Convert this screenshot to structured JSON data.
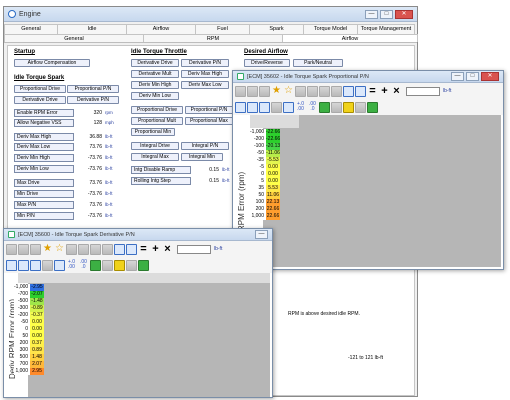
{
  "main": {
    "title": "Engine",
    "tabs_row1": [
      "General",
      "Idle",
      "Airflow",
      "Fuel",
      "Spark",
      "Torque Model",
      "Torque Management"
    ],
    "tabs_row2": [
      "General",
      "RPM",
      "Airflow"
    ],
    "startup": {
      "heading": "Startup",
      "airflow_comp": "Airflow Compensation"
    },
    "idle_spark": {
      "heading": "Idle Torque Spark",
      "buttons": [
        "Proportional Drive",
        "Proportional P/N",
        "Derivative Drive",
        "Derivative P/N"
      ],
      "values": [
        {
          "label": "Enable RPM Error",
          "value": "320",
          "unit": "rpm"
        },
        {
          "label": "Allow Negative VSS",
          "value": "128",
          "unit": "mph"
        },
        {
          "label": "Deriv Max High",
          "value": "36.88",
          "unit": "lb-ft"
        },
        {
          "label": "Deriv Max Low",
          "value": "73.76",
          "unit": "lb-ft"
        },
        {
          "label": "Deriv Min High",
          "value": "-73.76",
          "unit": "lb-ft"
        },
        {
          "label": "Deriv Min Low",
          "value": "-73.76",
          "unit": "lb-ft"
        },
        {
          "label": "Max Drive",
          "value": "73.76",
          "unit": "lb-ft"
        },
        {
          "label": "Min Drive",
          "value": "-73.76",
          "unit": "lb-ft"
        },
        {
          "label": "Max P/N",
          "value": "73.76",
          "unit": "lb-ft"
        },
        {
          "label": "Min P/N",
          "value": "-73.76",
          "unit": "lb-ft"
        }
      ]
    },
    "idle_throttle": {
      "heading": "Idle Torque Throttle",
      "buttons": [
        "Derivative Drive",
        "Derivative P/N",
        "Derivative Mult",
        "Deriv Max High",
        "Deriv Min High",
        "Deriv Max Low",
        "Deriv Min Low",
        "Proportional Drive",
        "Proportional P/N",
        "Proportional Mult",
        "Proportional Max",
        "Proportional Min",
        "Integral Drive",
        "Integral P/N",
        "Integral Max",
        "Integral Min"
      ],
      "values": [
        {
          "label": "Intg Disable Ramp",
          "value": "0.15",
          "unit": "lb-ft"
        },
        {
          "label": "Rolling Intg Step",
          "value": "0.15",
          "unit": "lb-ft"
        }
      ]
    },
    "desired_airflow": {
      "heading": "Desired Airflow",
      "buttons": [
        "Drive/Reverse",
        "Park/Neutral"
      ]
    },
    "status": {
      "message": "RPM is above desired idle RPM.",
      "range": "-121 to 121 lb-ft"
    }
  },
  "spark_pn": {
    "title": "[ECM] 35602 - Idle Torque Spark Proportional P/N",
    "unit": "lb-ft",
    "y_label": "RPM Error (rpm)",
    "rows": [
      {
        "key": "-1,000",
        "value": "-22.66",
        "color": "#2ccf2c"
      },
      {
        "key": "-200",
        "value": "-22.66",
        "color": "#2ccf2c"
      },
      {
        "key": "-100",
        "value": "-20.13",
        "color": "#46d446"
      },
      {
        "key": "-50",
        "value": "-11.06",
        "color": "#b8ec4a"
      },
      {
        "key": "-35",
        "value": "-5.53",
        "color": "#e4f550"
      },
      {
        "key": "-5",
        "value": "0.00",
        "color": "#ffff4a"
      },
      {
        "key": "0",
        "value": "0.00",
        "color": "#ffff4a"
      },
      {
        "key": "5",
        "value": "0.00",
        "color": "#ffff4a"
      },
      {
        "key": "35",
        "value": "5.53",
        "color": "#ffe84a"
      },
      {
        "key": "50",
        "value": "11.06",
        "color": "#ffd040"
      },
      {
        "key": "100",
        "value": "22.13",
        "color": "#ff9d2e"
      },
      {
        "key": "200",
        "value": "22.66",
        "color": "#ff9d2e"
      },
      {
        "key": "1,000",
        "value": "22.66",
        "color": "#ff9d2e"
      }
    ]
  },
  "spark_deriv": {
    "title": "[ECM] 35600 - Idle Torque Spark Derivative P/N",
    "unit": "lb-ft",
    "y_label": "Deriv RPM Error (rpm)",
    "rows": [
      {
        "key": "-1,000",
        "value": "-2.95",
        "color": "#2f6fe0"
      },
      {
        "key": "-700",
        "value": "-2.07",
        "color": "#2ccf2c"
      },
      {
        "key": "-500",
        "value": "-1.48",
        "color": "#9fe64a"
      },
      {
        "key": "-300",
        "value": "-0.89",
        "color": "#d6f24e"
      },
      {
        "key": "-200",
        "value": "-0.37",
        "color": "#f2fa52"
      },
      {
        "key": "-50",
        "value": "0.00",
        "color": "#ffff4a"
      },
      {
        "key": "0",
        "value": "0.00",
        "color": "#ffff4a"
      },
      {
        "key": "50",
        "value": "0.00",
        "color": "#ffff4a"
      },
      {
        "key": "200",
        "value": "0.37",
        "color": "#fff04a"
      },
      {
        "key": "300",
        "value": "0.89",
        "color": "#ffe44a"
      },
      {
        "key": "500",
        "value": "1.48",
        "color": "#ffd040"
      },
      {
        "key": "700",
        "value": "2.07",
        "color": "#ffb83a"
      },
      {
        "key": "1,000",
        "value": "2.95",
        "color": "#ff8a2a"
      }
    ]
  }
}
